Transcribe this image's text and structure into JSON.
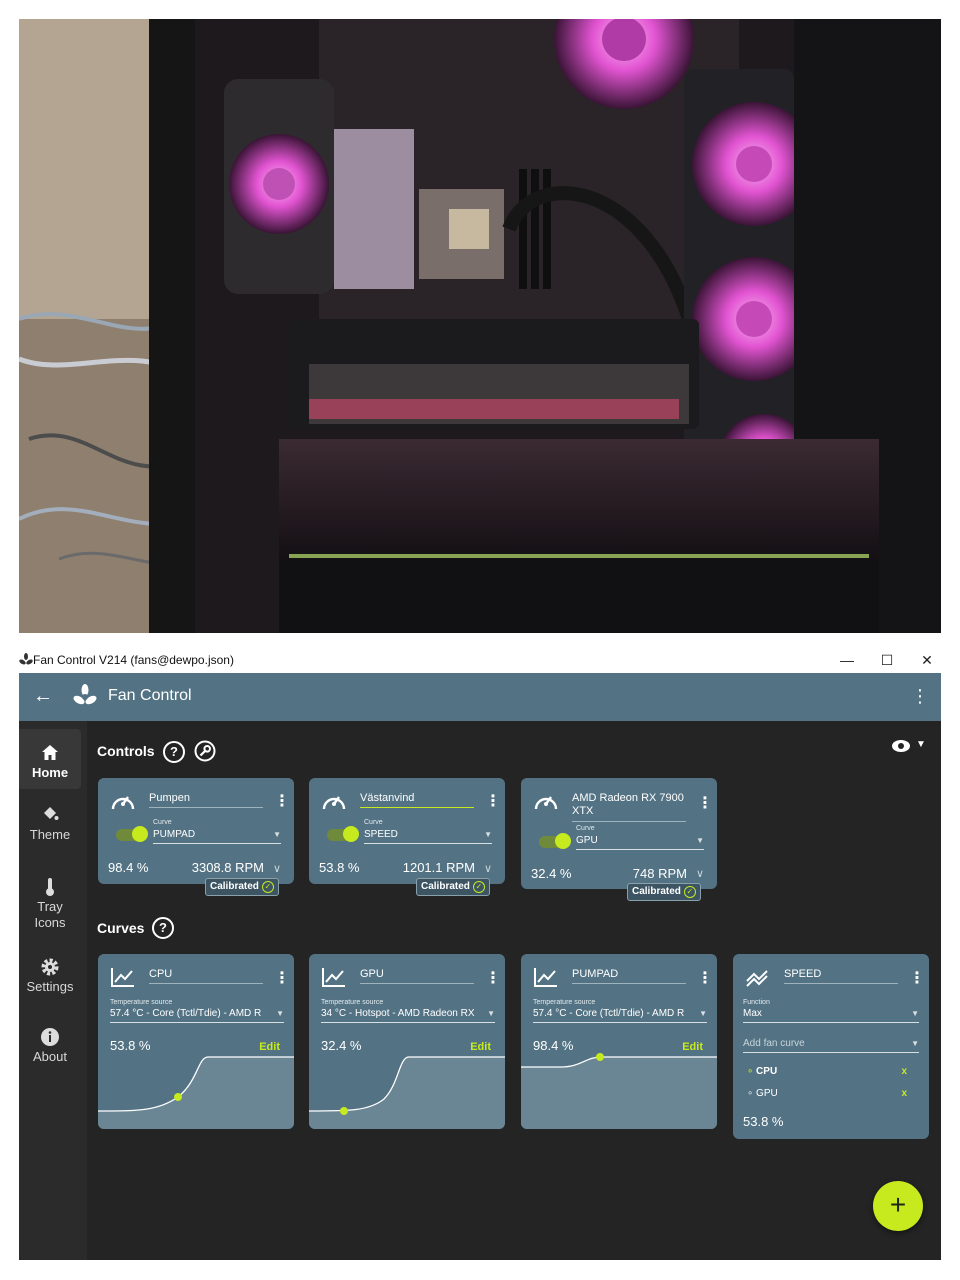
{
  "window": {
    "title": "Fan Control V214 (fans@dewpo.json)",
    "minimize": "—",
    "maximize": "☐",
    "close": "✕"
  },
  "appbar": {
    "back": "←",
    "title": "Fan Control",
    "menu": "⋮"
  },
  "sidebar": {
    "items": [
      {
        "label": "Home",
        "icon": "home-icon",
        "active": true
      },
      {
        "label": "Theme",
        "icon": "paint-bucket-icon"
      },
      {
        "label": "Tray Icons",
        "icon": "thermometer-icon"
      },
      {
        "label": "Settings",
        "icon": "gear-icon"
      },
      {
        "label": "About",
        "icon": "info-icon"
      }
    ]
  },
  "controls": {
    "heading": "Controls",
    "help": "?",
    "cards": [
      {
        "name": "Pumpen",
        "curve_label": "Curve",
        "curve": "PUMPAD",
        "percent": "98.4 %",
        "rpm": "3308.8 RPM",
        "badge": "Calibrated"
      },
      {
        "name": "Västanvind",
        "curve_label": "Curve",
        "curve": "SPEED",
        "percent": "53.8 %",
        "rpm": "1201.1 RPM",
        "badge": "Calibrated"
      },
      {
        "name": "AMD Radeon RX 7900 XTX",
        "curve_label": "Curve",
        "curve": "GPU",
        "percent": "32.4 %",
        "rpm": "748 RPM",
        "badge": "Calibrated"
      }
    ]
  },
  "curves": {
    "heading": "Curves",
    "help": "?",
    "cards": [
      {
        "name": "CPU",
        "source_label": "Temperature source",
        "source": "57.4 °C - Core (Tctl/Tdie) - AMD R",
        "percent": "53.8 %",
        "edit": "Edit",
        "point_fraction": 0.538
      },
      {
        "name": "GPU",
        "source_label": "Temperature source",
        "source": "34 °C - Hotspot - AMD Radeon RX",
        "percent": "32.4 %",
        "edit": "Edit",
        "point_fraction": 0.324
      },
      {
        "name": "PUMPAD",
        "source_label": "Temperature source",
        "source": "57.4 °C - Core (Tctl/Tdie) - AMD R",
        "percent": "98.4 %",
        "edit": "Edit",
        "point_fraction": 0.984
      }
    ],
    "mix": {
      "name": "SPEED",
      "function_label": "Function",
      "function": "Max",
      "add_placeholder": "Add fan curve",
      "items": [
        {
          "label": "CPU",
          "remove": "x"
        },
        {
          "label": "GPU",
          "remove": "x"
        }
      ],
      "percent": "53.8 %"
    }
  },
  "fab": "+",
  "colors": {
    "accent": "#c6ea1e",
    "card": "#537384",
    "background": "#242424",
    "appbar": "#537384"
  }
}
